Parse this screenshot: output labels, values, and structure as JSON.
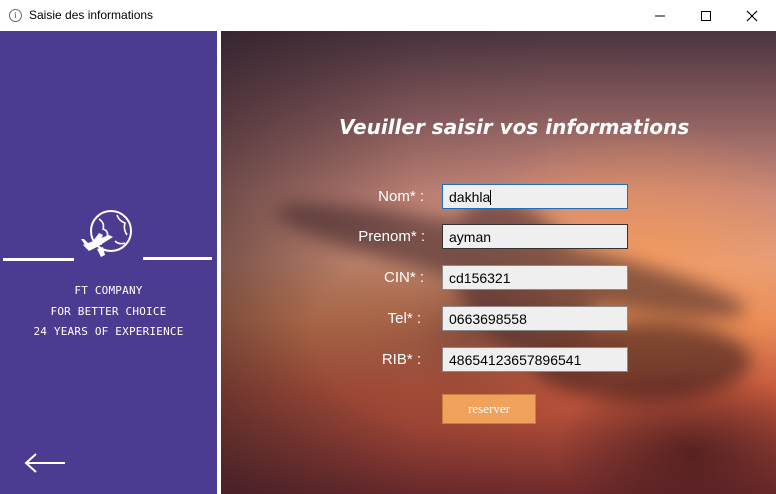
{
  "window": {
    "title": "Saisie des informations",
    "icon": "info-icon"
  },
  "sidebar": {
    "logo_icon": "globe-plane-icon",
    "company_lines": [
      "FT COMPANY",
      "FOR BETTER CHOICE",
      "24 YEARS OF EXPERIENCE"
    ],
    "back_icon": "arrow-left-icon",
    "background": "#4b3c92"
  },
  "form": {
    "heading": "Veuiller saisir vos informations",
    "fields": [
      {
        "label": "Nom* :",
        "value": "dakhla"
      },
      {
        "label": "Prenom* :",
        "value": "ayman"
      },
      {
        "label": "CIN* :",
        "value": "cd156321"
      },
      {
        "label": "Tel* :",
        "value": "0663698558"
      },
      {
        "label": "RIB* :",
        "value": "48654123657896541"
      }
    ],
    "submit_label": "reserver",
    "accent": "#f0a15c"
  }
}
